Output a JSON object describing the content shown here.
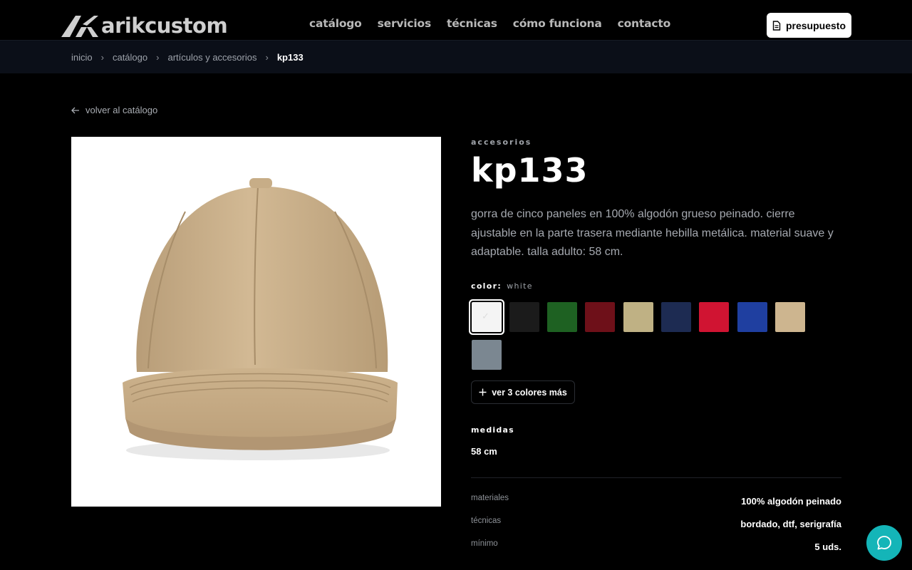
{
  "header": {
    "logo_text": "arikcustom",
    "nav": [
      "catálogo",
      "servicios",
      "técnicas",
      "cómo funciona",
      "contacto"
    ],
    "quote_button": "presupuesto"
  },
  "breadcrumb": {
    "items": [
      "inicio",
      "catálogo",
      "artículos y accesorios"
    ],
    "current": "kp133"
  },
  "back_link": "volver al catálogo",
  "product": {
    "category": "accesorios",
    "title": "kp133",
    "description": "gorra de cinco paneles en 100% algodón grueso peinado. cierre ajustable en la parte trasera mediante hebilla metálica. material suave y adaptable. talla adulto: 58 cm.",
    "color_label": "color:",
    "color_selected": "white",
    "swatches": [
      "#f4f4f4",
      "#1b1b1b",
      "#1e6122",
      "#6e1019",
      "#bfb184",
      "#1d2b52",
      "#d01432",
      "#1f3fa0",
      "#cdb58f",
      "#7b8791"
    ],
    "more_colors": "ver 3 colores más",
    "measures_label": "medidas",
    "measures_value": "58 cm",
    "specs": [
      {
        "label": "materiales",
        "value": "100% algodón peinado"
      },
      {
        "label": "técnicas",
        "value": "bordado, dtf, serigrafía"
      },
      {
        "label": "mínimo",
        "value": "5 uds."
      }
    ]
  },
  "colors": {
    "accent_chat": "#14b5b8",
    "breadcrumb_bg": "#0b0f18",
    "cap_color": "#cdb58f"
  }
}
